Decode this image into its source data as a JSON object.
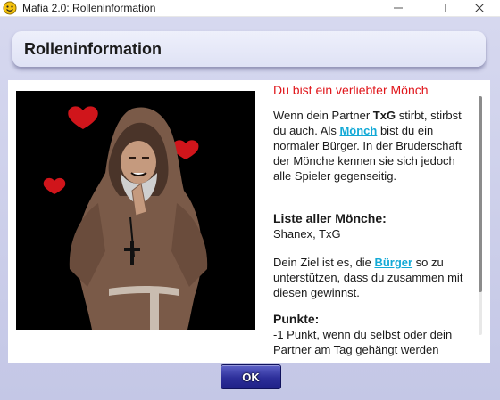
{
  "window": {
    "title": "Mafia 2.0: Rolleninformation",
    "app_icon": "smiley-icon"
  },
  "header": {
    "title": "Rolleninformation"
  },
  "role": {
    "heading": "Du bist ein verliebter Mönch",
    "image": "monk-with-hearts-illustration",
    "p1_a": "Wenn dein Partner ",
    "partner": "TxG",
    "p1_b": " stirbt, stirbst du auch. Als ",
    "p1_link": "Mönch",
    "p1_c": " bist du ein normaler Bürger. In der Bruderschaft der Mönche kennen sie sich jedoch alle Spieler gegenseitig.",
    "list_heading": "Liste aller Mönche:",
    "list_values": "Shanex, TxG",
    "p2_a": "Dein Ziel ist es, die ",
    "p2_link": "Bürger",
    "p2_b": " so zu unterstützen, dass du zusammen mit diesen gewinnst.",
    "points_heading": "Punkte:",
    "points_text": "-1 Punkt, wenn du selbst oder dein Partner am Tag gehängt werden"
  },
  "buttons": {
    "ok": "OK"
  },
  "colors": {
    "accent_red": "#e0161b",
    "link": "#12a9d6",
    "ok_button": "#2d2f9a",
    "window_bg": "#c4c7e6"
  }
}
